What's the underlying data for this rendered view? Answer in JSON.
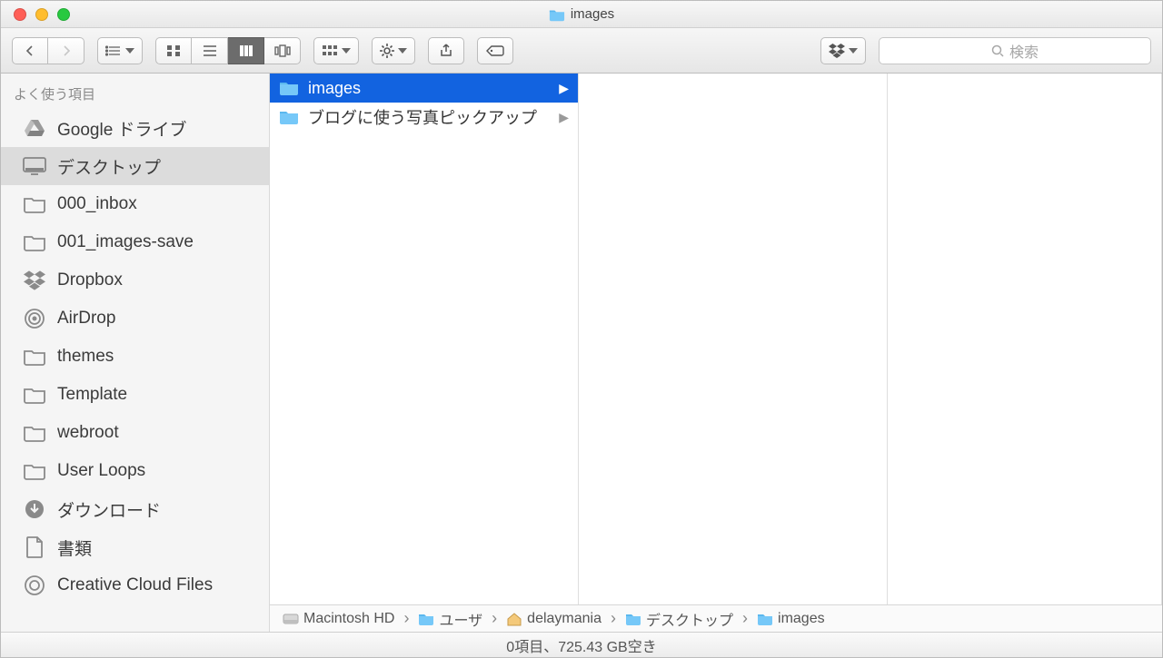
{
  "window": {
    "title": "images"
  },
  "toolbar": {
    "search_placeholder": "検索"
  },
  "sidebar": {
    "section_title": "よく使う項目",
    "items": [
      {
        "label": "Google ドライブ",
        "icon": "gdrive",
        "selected": false
      },
      {
        "label": "デスクトップ",
        "icon": "desktop",
        "selected": true
      },
      {
        "label": "000_inbox",
        "icon": "folder",
        "selected": false
      },
      {
        "label": "001_images-save",
        "icon": "folder",
        "selected": false
      },
      {
        "label": "Dropbox",
        "icon": "dropbox",
        "selected": false
      },
      {
        "label": "AirDrop",
        "icon": "airdrop",
        "selected": false
      },
      {
        "label": "themes",
        "icon": "folder",
        "selected": false
      },
      {
        "label": "Template",
        "icon": "folder",
        "selected": false
      },
      {
        "label": "webroot",
        "icon": "folder",
        "selected": false
      },
      {
        "label": "User Loops",
        "icon": "folder",
        "selected": false
      },
      {
        "label": "ダウンロード",
        "icon": "download",
        "selected": false
      },
      {
        "label": "書類",
        "icon": "document",
        "selected": false
      },
      {
        "label": "Creative Cloud Files",
        "icon": "cc",
        "selected": false
      }
    ]
  },
  "columns": [
    {
      "items": [
        {
          "label": "images",
          "kind": "folder-blue",
          "has_children": true,
          "selected": true
        },
        {
          "label": "ブログに使う写真ピックアップ",
          "kind": "folder-blue",
          "has_children": true,
          "selected": false
        }
      ]
    },
    {
      "items": []
    },
    {
      "items": []
    }
  ],
  "pathbar": [
    {
      "label": "Macintosh HD",
      "icon": "disk"
    },
    {
      "label": "ユーザ",
      "icon": "folder-blue"
    },
    {
      "label": "delaymania",
      "icon": "home"
    },
    {
      "label": "デスクトップ",
      "icon": "folder-blue"
    },
    {
      "label": "images",
      "icon": "folder-blue"
    }
  ],
  "status": {
    "text": "0項目、725.43 GB空き"
  }
}
